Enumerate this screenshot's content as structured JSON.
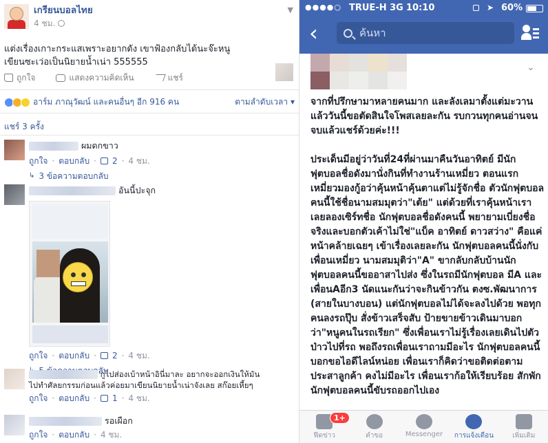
{
  "post": {
    "page_name": "เกรียนบอลไทย",
    "time": "4 ชม.",
    "text_line1": "แต่งเรื่องเกาะกระแสเพราะอยากดัง เขาฟ้องกลับได้นะจ๊ะหนู",
    "text_line2": "เขียนซะเว่อเป็นนิยายน้ำเน่า 555555",
    "actions": {
      "like": "ถูกใจ",
      "comment": "แสดงความคิดเห็น",
      "share": "แชร์"
    },
    "reactions_text": "อาร์ม ภาณุวัฒน์ และคนอื่นๆ อีก 916 คน",
    "sort_label": "ตามลำดับเวลา",
    "shares_text": "แชร์ 3 ครั้ง"
  },
  "comments": [
    {
      "text": "ผมดกขาว",
      "like": "ถูกใจ",
      "reply": "ตอบกลับ",
      "likes": "2",
      "time": "4 ชม.",
      "replies_label": "3 ข้อความตอบกลับ"
    },
    {
      "text": "อันนี้ปะจุก",
      "like": "ถูกใจ",
      "reply": "ตอบกลับ",
      "likes": "2",
      "time": "4 ชม.",
      "replies_label": "5 ข้อความตอบกลับ"
    },
    {
      "text_line1": "กูไปส่องเบ้าหน้าอินี่มาละ อยากจะออกเงินให้มัน",
      "text_line2": "ไปทำศัลยกรรมก่อนแล้วค่อยมาเขียนนิยายน้ำเน่าจังเลย สก๊อยเหี้ยๆ",
      "like": "ถูกใจ",
      "reply": "ตอบกลับ",
      "likes": "1",
      "time": "4 ชม."
    },
    {
      "text": "รอเผือก",
      "like": "ถูกใจ",
      "reply": "ตอบกลับ",
      "time": "4 ชม."
    }
  ],
  "ios": {
    "status": {
      "signal": "●●●●○",
      "carrier": "TRUE-H  3G",
      "time": "10:10",
      "battery": "60%"
    },
    "search_placeholder": "ค้นหา",
    "paragraph1": "จากที่ปรึกษามาหลายคนมาก และลังเลมาตั้งแต่มะวานแล้ววันนี้ขอตัดสินใจโพสเลยละกัน รบกวนทุกคนอ่านจนจบแล้วแชร์ด้วยค่ะ!!!",
    "paragraph2": "ประเด็นมีอยู่ว่าวันที่24ที่ผ่านมาคืนวันอาทิตย์ มีนักฟุตบอลชื่อดังมานั่งกินที่ทำงานร้านเหมี่ยว ตอนแรกเหมี่ยวมองกู้อว่าคุ้นหน้าคุ้นตาแต่ไม่รู้จักชื่อ ตัวนักฟุตบอลคนนี้ใช้ชื่อนามสมมุตว่า\"เต้ย\" แต่ด้วยที่เราคุ้นหน้าเราเลยลองเซิร์ทชื่อ นักฟุตบอลชื่อดังคนนี้ พยายามเบี่ยงชื่อจริงและบอกตัวเค้าไม่ใช่\"แบ็ค อาทิตย์ ดาวสว่าง\" คือแค่หน้าคล้ายเฉยๆ เข้าเรื่องเลยละกัน นักฟุตบอลคนนี้นั่งกับเพื่อนเหมี่ยว นามสมมุติว่า\"A\" ขากลับกลับบ้านนักฟุตบอลคนนี้ขออาสาไปส่ง ซึ่งในรถมีนักฟุตบอล มีA และเพื่อนAอีก3 นัดแนะกันว่าจะกินข้าวกัน ตงซ.พัฒนาการ (สายในบางบอน) แต่นักฟุตบอลไม่ได้จะลงไปด้วย พอทุกคนลงรถปุ๊บ สั่งข้าวเสร็จสับ ป้ายขายข้าวเดินมาบอกว่า\"หนูคนในรถเรียก\" ซึ่งเพื่อนเราไม่รู้เรื่องเลยเดินไปตัวป่าวไปที่รถ พอถึงรถเพื่อนเราถามมีอะไร นักฟุตบอลคนนี้บอกขอไอดีไลน์หน่อย เพื่อนเราก็คิดว่าขอติดต่อตามประสาลูกค้า คงไม่มีอะไร เพื่อนเราก้อให้เรียบร้อย สักพักนักฟุตบอลคนนี้ขับรถออกไปเอง",
    "tabs": [
      {
        "label": "ฟีดข่าว",
        "badge": "1+"
      },
      {
        "label": "คำขอ"
      },
      {
        "label": "Messenger"
      },
      {
        "label": "การแจ้งเตือน"
      },
      {
        "label": "เพิ่มเติม"
      }
    ],
    "colors": {
      "nav": "#4267b2",
      "search": "#365899",
      "badge": "#fa3e3e"
    }
  }
}
